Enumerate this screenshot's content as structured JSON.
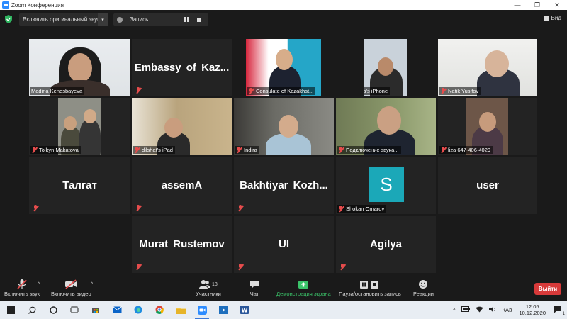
{
  "window": {
    "title": "Zoom Конференция",
    "controls": [
      "—",
      "❐",
      "✕"
    ]
  },
  "topbar": {
    "audio_button": "Включить оригинальный звук",
    "recording_label": "Запись...",
    "view_label": "Вид"
  },
  "participants": [
    {
      "name": "Madina Kenesbayeva",
      "video": true
    },
    {
      "name": "Embassy of Kaz...",
      "video": false
    },
    {
      "name": "Consulate of Kazakhst...",
      "video": true
    },
    {
      "name": "Karla's iPhone",
      "video": true
    },
    {
      "name": "Natik Yusifov",
      "video": true
    },
    {
      "name": "Tolkyn Makatova",
      "video": true
    },
    {
      "name": "dilshat's iPad",
      "video": true
    },
    {
      "name": "Indira",
      "video": true
    },
    {
      "name": "Подключение звука...",
      "video": true
    },
    {
      "name": "liza 647-406-4029",
      "video": true
    },
    {
      "name": "Талгат",
      "video": false
    },
    {
      "name": "assemA",
      "video": false
    },
    {
      "name": "Bakhtiyar Kozh...",
      "video": false
    },
    {
      "name": "Shokan Omarov",
      "video": false,
      "avatar_letter": "S",
      "avatar_color": "#1ba8b8"
    },
    {
      "name": "user",
      "video": false
    },
    {
      "name": "Murat Rustemov",
      "video": false
    },
    {
      "name": "UI",
      "video": false
    },
    {
      "name": "Agilya",
      "video": false
    }
  ],
  "toolbar": {
    "unmute": "Включить звук",
    "start_video": "Включить видео",
    "participants": "Участники",
    "participants_count": "18",
    "chat": "Чат",
    "share_screen": "Демонстрация экрана",
    "pause_stop_recording": "Пауза/остановить запись",
    "reactions": "Реакции",
    "leave": "Выйти"
  },
  "taskbar": {
    "language": "КАЗ",
    "time": "12:05",
    "date": "10.12.2020",
    "notifications": "1"
  },
  "colors": {
    "accent_active": "#c8e05a",
    "leave": "#d83a3a",
    "share": "#3bc46a",
    "avatar": "#1ba8b8"
  }
}
